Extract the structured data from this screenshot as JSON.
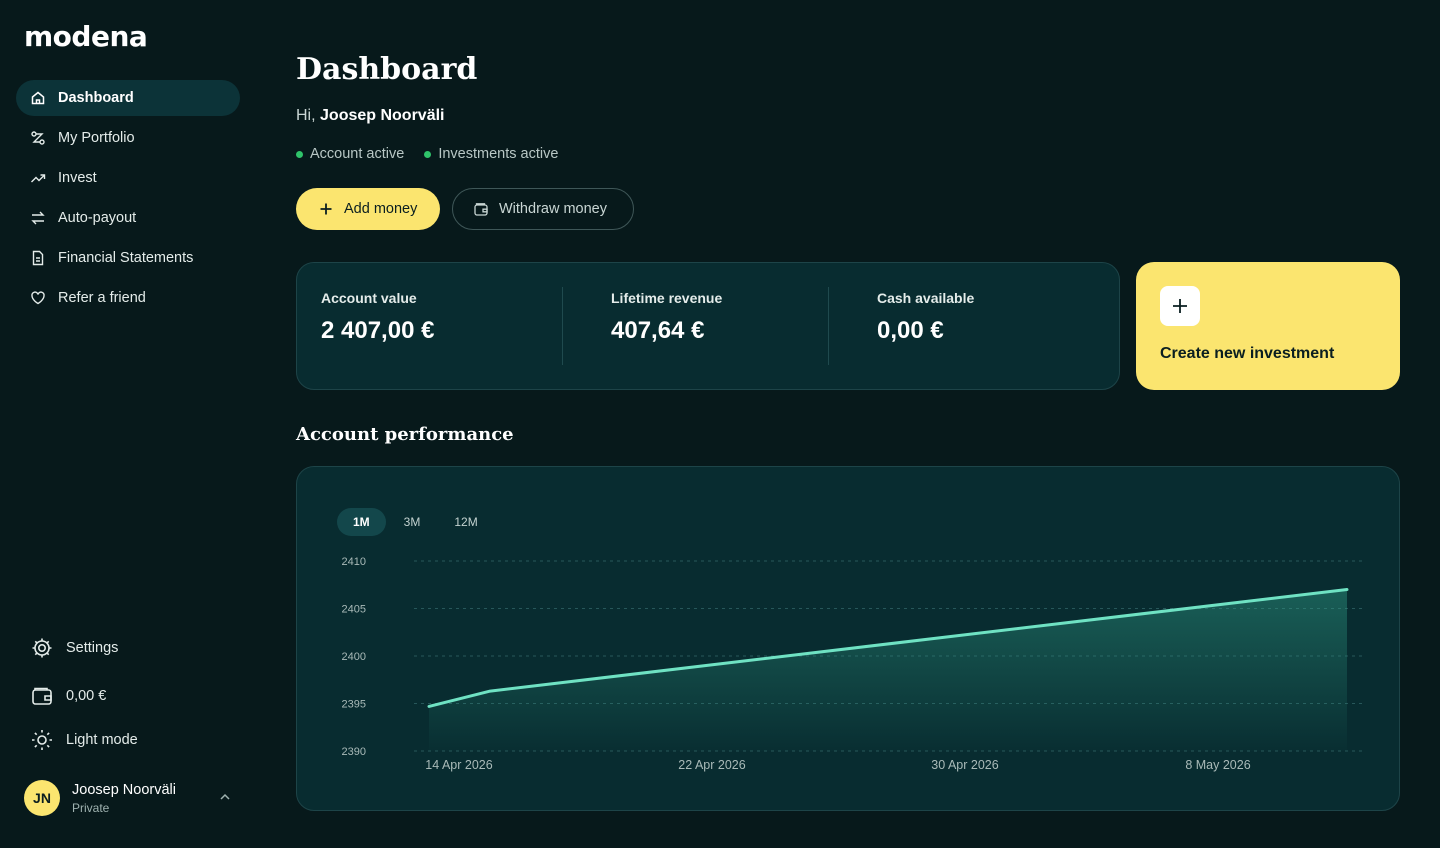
{
  "brand": {
    "logo": "modena"
  },
  "sidebar": {
    "items": [
      {
        "label": "Dashboard",
        "icon": "home-icon",
        "active": true
      },
      {
        "label": "My Portfolio",
        "icon": "portfolio-icon"
      },
      {
        "label": "Invest",
        "icon": "trend-up-icon"
      },
      {
        "label": "Auto-payout",
        "icon": "swap-icon"
      },
      {
        "label": "Financial Statements",
        "icon": "document-icon"
      },
      {
        "label": "Refer a friend",
        "icon": "heart-icon"
      }
    ],
    "settings": "Settings",
    "wallet_balance": "0,00 €",
    "theme_toggle": "Light mode",
    "user": {
      "initials": "JN",
      "name": "Joosep Noorväli",
      "type": "Private"
    }
  },
  "header": {
    "title": "Dashboard",
    "greeting_prefix": "Hi,",
    "user_name": "Joosep Noorväli",
    "statuses": [
      "Account active",
      "Investments active"
    ]
  },
  "actions": {
    "add_money": "Add money",
    "withdraw_money": "Withdraw money"
  },
  "stats": [
    {
      "label": "Account value",
      "value": "2 407,00 €"
    },
    {
      "label": "Lifetime revenue",
      "value": "407,64 €"
    },
    {
      "label": "Cash available",
      "value": "0,00 €"
    }
  ],
  "create_investment": "Create new investment",
  "performance": {
    "title": "Account performance",
    "ranges": [
      "1M",
      "3M",
      "12M"
    ],
    "active_range": "1M"
  },
  "colors": {
    "accent": "#fbe56f",
    "line": "#6fe2c3",
    "status": "#2fc36a",
    "background": "#07191b",
    "card": "#082c30"
  },
  "chart_data": {
    "type": "area",
    "x": [
      "2026-04-14",
      "2026-04-16",
      "2026-05-14"
    ],
    "values": [
      2394.7,
      2396.3,
      2407.0
    ],
    "xticks": [
      "14 Apr 2026",
      "22 Apr 2026",
      "30 Apr 2026",
      "8 May 2026"
    ],
    "yticks": [
      2390,
      2395,
      2400,
      2405,
      2410
    ],
    "ylim": [
      2390,
      2410
    ],
    "grid": true
  }
}
